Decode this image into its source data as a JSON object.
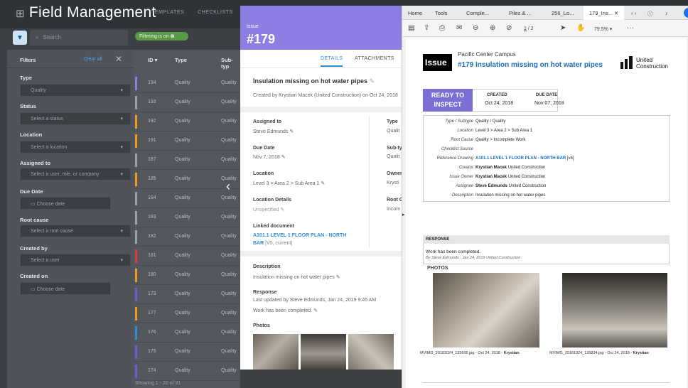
{
  "app": {
    "title": "Field Management",
    "nav": [
      "TEMPLATES",
      "CHECKLISTS"
    ]
  },
  "search": {
    "placeholder": "Search"
  },
  "filter_chip": "Filtering is on",
  "filters": {
    "title": "Filters",
    "clear_all": "Clear all",
    "groups": [
      {
        "label": "Type",
        "value": "Quality"
      },
      {
        "label": "Status",
        "value": "Select a status"
      },
      {
        "label": "Location",
        "value": "Select a location"
      },
      {
        "label": "Assigned to",
        "value": "Select a user, role, or company"
      },
      {
        "label": "Due Date",
        "value": "Choose date"
      },
      {
        "label": "Root cause",
        "value": "Select a root cause"
      },
      {
        "label": "Created by",
        "value": "Select a user"
      },
      {
        "label": "Created on",
        "value": "Choose date"
      }
    ]
  },
  "grid": {
    "headers": [
      "ID",
      "Type",
      "Sub-typ"
    ],
    "rows": [
      {
        "id": "194",
        "type": "Quality",
        "sub": "Quality",
        "color": "#8c7ee3"
      },
      {
        "id": "193",
        "type": "Quality",
        "sub": "Quality",
        "color": "#9aa0a6"
      },
      {
        "id": "192",
        "type": "Quality",
        "sub": "Quality",
        "color": "#f29a1b"
      },
      {
        "id": "191",
        "type": "Quality",
        "sub": "Quality",
        "color": "#f29a1b"
      },
      {
        "id": "187",
        "type": "Quality",
        "sub": "Quality",
        "color": "#9aa0a6"
      },
      {
        "id": "185",
        "type": "Quality",
        "sub": "Quality",
        "color": "#f29a1b"
      },
      {
        "id": "184",
        "type": "Quality",
        "sub": "Quality",
        "color": "#9aa0a6"
      },
      {
        "id": "183",
        "type": "Quality",
        "sub": "Quality",
        "color": "#9aa0a6"
      },
      {
        "id": "182",
        "type": "Quality",
        "sub": "Quality",
        "color": "#9aa0a6"
      },
      {
        "id": "181",
        "type": "Quality",
        "sub": "Quality",
        "color": "#d93c3c"
      },
      {
        "id": "180",
        "type": "Quality",
        "sub": "Quality",
        "color": "#f29a1b"
      },
      {
        "id": "179",
        "type": "Quality",
        "sub": "Quality",
        "color": "#6a5ed6"
      },
      {
        "id": "177",
        "type": "Quality",
        "sub": "Quality",
        "color": "#f29a1b"
      },
      {
        "id": "176",
        "type": "Quality",
        "sub": "Quality",
        "color": "#2d8ed8"
      },
      {
        "id": "175",
        "type": "Quality",
        "sub": "Quality",
        "color": "#6a5ed6"
      },
      {
        "id": "174",
        "type": "Quality",
        "sub": "Quality",
        "color": "#6a5ed6"
      }
    ],
    "showing": "Showing 1 - 20 of 91"
  },
  "issue": {
    "label": "Issue",
    "number": "#179",
    "tabs": [
      "DETAILS",
      "ATTACHMENTS"
    ],
    "title": "Insulation missing on hot water pipes",
    "created": "Created by Krystian Macek (United Construction) on Oct 24, 2018",
    "assigned_label": "Assigned to",
    "assigned": "Steve Edmunds",
    "due_label": "Due Date",
    "due": "Nov 7, 2018",
    "location_label": "Location",
    "location": "Level 3 > Area 2 > Sub Area 1",
    "locdet_label": "Location Details",
    "locdet": "Unspecified",
    "linked_label": "Linked document",
    "linked1": "A101.1 LEVEL 1 FLOOR PLAN - NORTH",
    "linked2": "BAR",
    "linked_note": " [V5, current]",
    "type_label": "Type",
    "type": "Qualit",
    "subtype_label": "Sub-ty",
    "subtype": "Qualit",
    "owner_label": "Owner",
    "owner": "Krysti",
    "root_label": "Root C",
    "root": "Incom",
    "desc_label": "Description",
    "desc": "Insulation missing on hot water pipes",
    "resp_label": "Response",
    "resp_meta": "Last updated by Steve Edmunds, Jan 24, 2019 9:45 AM",
    "resp": "Work has been completed.",
    "photos_label": "Photos"
  },
  "pdf": {
    "menu": [
      "Home",
      "Tools",
      "Comple...",
      "Piles & ...",
      "256_Lo...",
      "179_Ins..."
    ],
    "page_field": "1",
    "page_total": "/ 2",
    "zoom": "79.5%",
    "project": "Pacific Center Campus",
    "badge": "Issue",
    "heading": "#179 Insulation missing on hot water pipes",
    "brand1": "United",
    "brand2": "Construction",
    "status1": "READY TO",
    "status2": "INSPECT",
    "created_label": "CREATED",
    "created": "Oct 24, 2018",
    "due_label": "DUE DATE",
    "due": "Nov 07, 2018",
    "details": [
      {
        "k": "Type / Subtype",
        "v": "Quality / Quality",
        "b": ""
      },
      {
        "k": "Location",
        "v": "Level 3 > Area 2 > Sub Area 1",
        "b": ""
      },
      {
        "k": "Root Cause",
        "v": "Quality > Incomplete Work",
        "b": ""
      },
      {
        "k": "Checklist Source",
        "v": "",
        "b": ""
      },
      {
        "k": "Reference Drawing",
        "v": " [v4]",
        "b": "A101.1 LEVEL 1 FLOOR PLAN - NORTH BAR"
      },
      {
        "k": "Creator",
        "v": " United Construction",
        "b": "Krystian Macek"
      },
      {
        "k": "Issue Owner",
        "v": " United Construction",
        "b": "Krystian Macek"
      },
      {
        "k": "Assignee",
        "v": " United Construction",
        "b": "Steve Edmunds"
      },
      {
        "k": "Description",
        "v": "Insulation missing on hot water pipes",
        "b": ""
      }
    ],
    "response_label": "RESPONSE",
    "response": "Work has been completed.",
    "response_meta": "By Steve Edmunds - Jan 24, 2019 United Construction",
    "photos_label": "PHOTOS",
    "cap1": "MVIMG_20181024_135606.jpg - Oct 24, 2018 - ",
    "cap1b": "Krystian",
    "cap2": "MVIMG_20181024_135834.jpg - Oct 24, 2018 - ",
    "cap2b": "Krystian"
  }
}
